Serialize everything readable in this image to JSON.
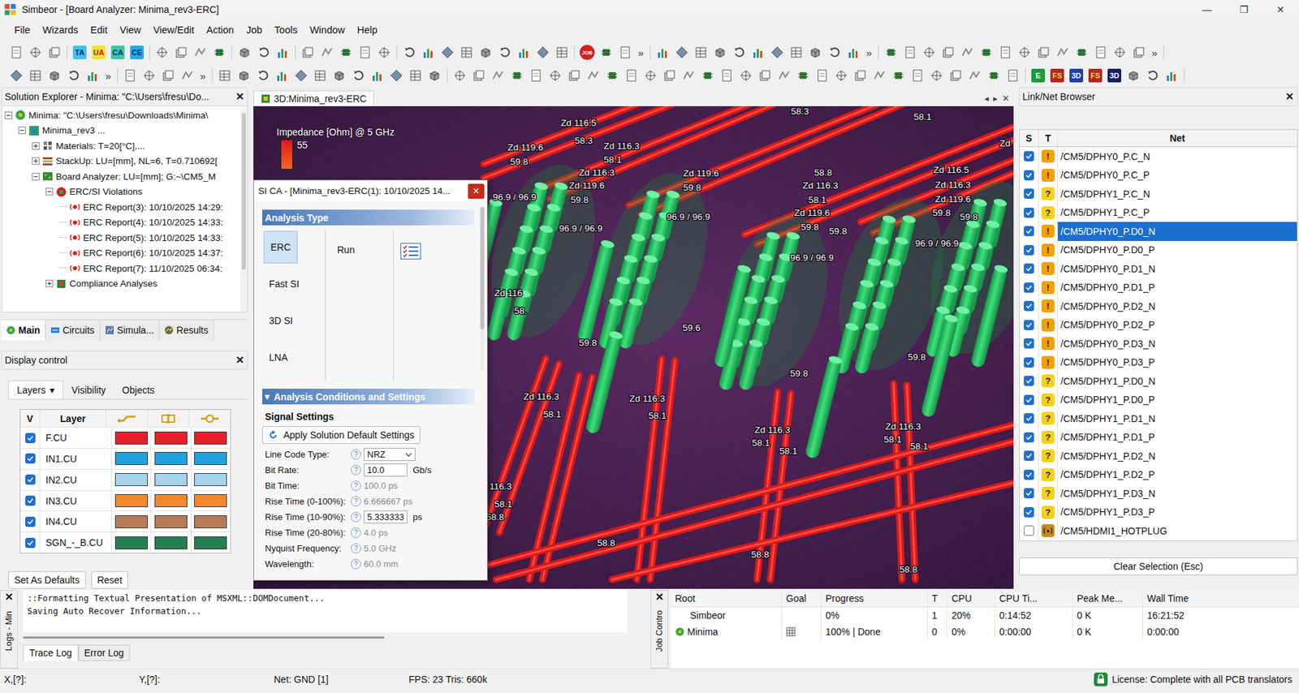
{
  "window": {
    "title": "Simbeor - [Board Analyzer: Minima_rev3-ERC]",
    "controls": [
      "—",
      "❐",
      "✕"
    ]
  },
  "menu": [
    "File",
    "Wizards",
    "Edit",
    "View",
    "View/Edit",
    "Action",
    "Job",
    "Tools",
    "Window",
    "Help"
  ],
  "toolbars": [
    [
      [
        {
          "kind": "icon"
        },
        {
          "kind": "icon"
        },
        {
          "kind": "icon"
        }
      ],
      [
        {
          "kind": "badge",
          "label": "TA",
          "color": "#3fc2e8",
          "text_color": "#0b2a8f"
        },
        {
          "kind": "badge",
          "label": "UA",
          "color": "#f7e03a",
          "text_color": "#d0161b"
        },
        {
          "kind": "badge",
          "label": "CA",
          "color": "#3ec7a0",
          "text_color": "#0b2a8f"
        },
        {
          "kind": "badge",
          "label": "CE",
          "color": "#2aa8e0",
          "text_color": "#0b2a8f"
        }
      ],
      [
        {
          "kind": "icon"
        },
        {
          "kind": "icon"
        },
        {
          "kind": "icon"
        },
        {
          "kind": "icon"
        }
      ],
      [
        {
          "kind": "icon"
        },
        {
          "kind": "icon"
        },
        {
          "kind": "icon"
        }
      ],
      [
        {
          "kind": "icon"
        },
        {
          "kind": "icon"
        },
        {
          "kind": "icon"
        },
        {
          "kind": "icon"
        },
        {
          "kind": "icon"
        }
      ],
      [
        {
          "kind": "icon"
        },
        {
          "kind": "icon"
        },
        {
          "kind": "icon"
        },
        {
          "kind": "icon"
        },
        {
          "kind": "icon"
        },
        {
          "kind": "icon"
        },
        {
          "kind": "icon"
        },
        {
          "kind": "icon"
        },
        {
          "kind": "icon"
        }
      ],
      [
        {
          "kind": "round",
          "label": "JOB",
          "color": "#d32020",
          "text_color": "#ffffff"
        },
        {
          "kind": "icon"
        },
        {
          "kind": "icon"
        },
        {
          "kind": "more",
          "label": "»"
        }
      ],
      [
        {
          "kind": "icon"
        },
        {
          "kind": "icon"
        },
        {
          "kind": "icon"
        },
        {
          "kind": "icon"
        },
        {
          "kind": "icon"
        },
        {
          "kind": "icon"
        },
        {
          "kind": "icon"
        },
        {
          "kind": "icon"
        },
        {
          "kind": "icon"
        },
        {
          "kind": "icon"
        },
        {
          "kind": "icon"
        },
        {
          "kind": "more",
          "label": "»"
        }
      ],
      [
        {
          "kind": "icon"
        },
        {
          "kind": "icon"
        },
        {
          "kind": "icon"
        },
        {
          "kind": "icon"
        },
        {
          "kind": "icon"
        },
        {
          "kind": "icon"
        },
        {
          "kind": "icon"
        },
        {
          "kind": "icon"
        },
        {
          "kind": "icon"
        },
        {
          "kind": "icon"
        },
        {
          "kind": "icon"
        },
        {
          "kind": "icon"
        },
        {
          "kind": "icon"
        },
        {
          "kind": "icon"
        },
        {
          "kind": "more",
          "label": "»"
        }
      ]
    ],
    [
      [
        {
          "kind": "icon"
        },
        {
          "kind": "icon"
        },
        {
          "kind": "icon"
        },
        {
          "kind": "icon"
        },
        {
          "kind": "icon"
        },
        {
          "kind": "more",
          "label": "»"
        }
      ],
      [
        {
          "kind": "icon"
        },
        {
          "kind": "icon"
        },
        {
          "kind": "icon"
        },
        {
          "kind": "icon"
        },
        {
          "kind": "more",
          "label": "»"
        }
      ],
      [
        {
          "kind": "icon"
        },
        {
          "kind": "icon"
        },
        {
          "kind": "icon"
        },
        {
          "kind": "icon"
        },
        {
          "kind": "icon"
        },
        {
          "kind": "icon"
        },
        {
          "kind": "icon"
        },
        {
          "kind": "icon"
        },
        {
          "kind": "icon"
        },
        {
          "kind": "icon"
        },
        {
          "kind": "icon"
        },
        {
          "kind": "icon"
        }
      ],
      [
        {
          "kind": "icon"
        },
        {
          "kind": "icon"
        },
        {
          "kind": "icon"
        },
        {
          "kind": "icon"
        },
        {
          "kind": "icon"
        },
        {
          "kind": "icon"
        },
        {
          "kind": "icon"
        },
        {
          "kind": "icon"
        },
        {
          "kind": "icon"
        },
        {
          "kind": "icon"
        },
        {
          "kind": "icon"
        },
        {
          "kind": "icon"
        },
        {
          "kind": "icon"
        },
        {
          "kind": "icon"
        },
        {
          "kind": "icon"
        },
        {
          "kind": "icon"
        },
        {
          "kind": "icon"
        },
        {
          "kind": "icon"
        },
        {
          "kind": "icon"
        },
        {
          "kind": "icon"
        },
        {
          "kind": "icon"
        },
        {
          "kind": "icon"
        },
        {
          "kind": "icon"
        },
        {
          "kind": "icon"
        },
        {
          "kind": "icon"
        },
        {
          "kind": "icon"
        },
        {
          "kind": "icon"
        },
        {
          "kind": "icon"
        },
        {
          "kind": "icon"
        },
        {
          "kind": "icon"
        }
      ],
      [
        {
          "kind": "badge",
          "label": "E",
          "color": "#1a9b3c",
          "text_color": "#ffffff"
        },
        {
          "kind": "badge",
          "label": "FS",
          "color": "#b3261e",
          "text_color": "#ffd54a"
        },
        {
          "kind": "badge",
          "label": "3D",
          "color": "#1c3fa8",
          "text_color": "#ffffff"
        },
        {
          "kind": "badge",
          "label": "FS",
          "color": "#b3261e",
          "text_color": "#ffd54a"
        },
        {
          "kind": "badge",
          "label": "3D",
          "color": "#13205e",
          "text_color": "#ffffff"
        },
        {
          "kind": "icon"
        },
        {
          "kind": "icon"
        },
        {
          "kind": "icon"
        }
      ]
    ]
  ],
  "solution_explorer": {
    "title": "Solution Explorer - Minima: \"C:\\Users\\fresu\\Do...",
    "close": "✕",
    "items": [
      {
        "label": "Minima: \"C:\\Users\\fresu\\Downloads\\Minima\\",
        "level": 0,
        "expandable": true,
        "expanded": true,
        "kind": "solution"
      },
      {
        "label": "Minima_rev3 ...",
        "level": 1,
        "expandable": true,
        "expanded": true,
        "kind": "doc"
      },
      {
        "label": "Materials: T=20[°C],...",
        "level": 2,
        "expandable": true,
        "expanded": false,
        "kind": "materials"
      },
      {
        "label": "StackUp: LU=[mm], NL=6, T=0.710692[",
        "level": 2,
        "expandable": true,
        "expanded": false,
        "kind": "stackup"
      },
      {
        "label": "Board Analyzer: LU=[mm]; G:~\\CM5_M",
        "level": 2,
        "expandable": true,
        "expanded": true,
        "kind": "board"
      },
      {
        "label": "ERC/SI Violations",
        "level": 3,
        "expandable": true,
        "expanded": true,
        "kind": "erc"
      },
      {
        "label": "ERC Report(3): 10/10/2025 14:29:",
        "level": 4,
        "expandable": false,
        "expanded": false,
        "kind": "report"
      },
      {
        "label": "ERC Report(4): 10/10/2025 14:33:",
        "level": 4,
        "expandable": false,
        "expanded": false,
        "kind": "report"
      },
      {
        "label": "ERC Report(5): 10/10/2025 14:33:",
        "level": 4,
        "expandable": false,
        "expanded": false,
        "kind": "report"
      },
      {
        "label": "ERC Report(6): 10/10/2025 14:37:",
        "level": 4,
        "expandable": false,
        "expanded": false,
        "kind": "report"
      },
      {
        "label": "ERC Report(7): 11/10/2025 06:34:",
        "level": 4,
        "expandable": false,
        "expanded": false,
        "kind": "report"
      },
      {
        "label": "Compliance Analyses",
        "level": 3,
        "expandable": true,
        "expanded": false,
        "kind": "compliance"
      }
    ]
  },
  "left_tabs": [
    {
      "label": "Main",
      "selected": true,
      "kind": "main"
    },
    {
      "label": "Circuits",
      "selected": false,
      "kind": "circuits"
    },
    {
      "label": "Simula...",
      "selected": false,
      "kind": "simulation"
    },
    {
      "label": "Results",
      "selected": false,
      "kind": "results"
    }
  ],
  "display_control": {
    "title": "Display control",
    "close": "✕",
    "tabs": [
      {
        "label": "Layers",
        "selected": true,
        "dropdown": "▾"
      },
      {
        "label": "Visibility",
        "selected": false
      },
      {
        "label": "Objects",
        "selected": false
      }
    ],
    "columns": [
      "V",
      "Layer"
    ],
    "layers": [
      {
        "name": "F.CU",
        "visible": true,
        "color": "#e5202a"
      },
      {
        "name": "IN1.CU",
        "visible": true,
        "color": "#1fa2e0"
      },
      {
        "name": "IN2.CU",
        "visible": true,
        "color": "#a6d3ee"
      },
      {
        "name": "IN3.CU",
        "visible": true,
        "color": "#f5882a"
      },
      {
        "name": "IN4.CU",
        "visible": true,
        "color": "#b87b58"
      },
      {
        "name": "SGN_-_B.CU",
        "visible": true,
        "color": "#24804f"
      }
    ],
    "buttons": [
      "Set As Defaults",
      "Reset"
    ]
  },
  "doc_tab": {
    "label": "3D:Minima_rev3-ERC",
    "nav": [
      "◂",
      "▸",
      "✕"
    ]
  },
  "canvas": {
    "legend": {
      "title": "Impedance [Ohm] @ 5 GHz",
      "value": "55"
    },
    "labels": [
      "58.3",
      "58.1",
      "Zd 116.5",
      "58.3",
      "Zd 116.3",
      "58.1",
      "Zd 119.6",
      "59.8",
      "Zd 116.3",
      "Zd 119.6",
      "59.8",
      "Zd 119.6",
      "59.8",
      "58.8",
      "Zd 116.3",
      "58.1",
      "Zd 119.6",
      "59.8",
      "59.8",
      "Zd 116.5",
      "Zd 116.3",
      "Zd 119.6",
      "59.8",
      "59.8",
      "Zd",
      "96.9 / 96.9",
      "96.9 / 96.9",
      "96.9 / 96.9",
      "96.9 / 96.9",
      "96.9 / 96.9",
      "Zd 116",
      "58.",
      "59.8",
      "59.6",
      "59.8",
      "59.8",
      "Zd 116.3",
      "58.1",
      "Zd 116.3",
      "58.1",
      "Zd 116.3",
      "58.1",
      "58.1",
      "Zd 116.3",
      "58.1",
      "58.1",
      "116.3",
      "58.1",
      "58.8",
      "58.8",
      "58.8",
      "58.8"
    ]
  },
  "dialog": {
    "title": "SI CA - [Minima_rev3-ERC(1): 10/10/2025 14...",
    "close": "×",
    "analysis_header": "Analysis Type",
    "analysis_types": [
      {
        "label": "ERC",
        "selected": true
      },
      {
        "label": "Fast SI",
        "selected": false
      },
      {
        "label": "3D SI",
        "selected": false
      },
      {
        "label": "LNA",
        "selected": false
      }
    ],
    "run": "Run",
    "settings_glyph": "▾",
    "settings_header": "Analysis Conditions and Settings",
    "group": "Signal Settings",
    "apply_button": "Apply Solution Default Settings",
    "help_glyph": "?",
    "fields": [
      {
        "label": "Line Code Type:",
        "value": "NRZ",
        "kind": "select"
      },
      {
        "label": "Bit Rate:",
        "value": "10.0",
        "unit": "Gb/s",
        "kind": "input"
      },
      {
        "label": "Bit Time:",
        "value": "100.0 ps",
        "kind": "readonly"
      },
      {
        "label": "Rise Time (0-100%):",
        "value": "6.666667 ps",
        "kind": "readonly"
      },
      {
        "label": "Rise Time (10-90%):",
        "value": "5.333333",
        "unit": "ps",
        "kind": "input"
      },
      {
        "label": "Rise Time (20-80%):",
        "value": "4.0 ps",
        "kind": "readonly"
      },
      {
        "label": "Nyquist Frequency:",
        "value": "5.0 GHz",
        "kind": "readonly"
      },
      {
        "label": "Wavelength:",
        "value": "60.0 mm",
        "kind": "readonly"
      }
    ]
  },
  "net_browser": {
    "title": "Link/Net Browser",
    "close": "✕",
    "columns": [
      "S",
      "T",
      "Net"
    ],
    "rows": [
      {
        "net": "/CM5/DPHY0_P.C_N",
        "checked": true,
        "selected": false,
        "type_glyph": "!",
        "type_color": "#f5a000"
      },
      {
        "net": "/CM5/DPHY0_P.C_P",
        "checked": true,
        "selected": false,
        "type_glyph": "!",
        "type_color": "#f5a000"
      },
      {
        "net": "/CM5/DPHY1_P.C_N",
        "checked": true,
        "selected": false,
        "type_glyph": "?",
        "type_color": "#f7d118"
      },
      {
        "net": "/CM5/DPHY1_P.C_P",
        "checked": true,
        "selected": false,
        "type_glyph": "?",
        "type_color": "#f7d118"
      },
      {
        "net": "/CM5/DPHY0_P.D0_N",
        "checked": true,
        "selected": true,
        "type_glyph": "!",
        "type_color": "#f5a000"
      },
      {
        "net": "/CM5/DPHY0_P.D0_P",
        "checked": true,
        "selected": false,
        "type_glyph": "!",
        "type_color": "#f5a000"
      },
      {
        "net": "/CM5/DPHY0_P.D1_N",
        "checked": true,
        "selected": false,
        "type_glyph": "!",
        "type_color": "#f5a000"
      },
      {
        "net": "/CM5/DPHY0_P.D1_P",
        "checked": true,
        "selected": false,
        "type_glyph": "!",
        "type_color": "#f5a000"
      },
      {
        "net": "/CM5/DPHY0_P.D2_N",
        "checked": true,
        "selected": false,
        "type_glyph": "!",
        "type_color": "#f5a000"
      },
      {
        "net": "/CM5/DPHY0_P.D2_P",
        "checked": true,
        "selected": false,
        "type_glyph": "!",
        "type_color": "#f5a000"
      },
      {
        "net": "/CM5/DPHY0_P.D3_N",
        "checked": true,
        "selected": false,
        "type_glyph": "!",
        "type_color": "#f5a000"
      },
      {
        "net": "/CM5/DPHY0_P.D3_P",
        "checked": true,
        "selected": false,
        "type_glyph": "!",
        "type_color": "#f5a000"
      },
      {
        "net": "/CM5/DPHY1_P.D0_N",
        "checked": true,
        "selected": false,
        "type_glyph": "?",
        "type_color": "#f7d118"
      },
      {
        "net": "/CM5/DPHY1_P.D0_P",
        "checked": true,
        "selected": false,
        "type_glyph": "?",
        "type_color": "#f7d118"
      },
      {
        "net": "/CM5/DPHY1_P.D1_N",
        "checked": true,
        "selected": false,
        "type_glyph": "?",
        "type_color": "#f7d118"
      },
      {
        "net": "/CM5/DPHY1_P.D1_P",
        "checked": true,
        "selected": false,
        "type_glyph": "?",
        "type_color": "#f7d118"
      },
      {
        "net": "/CM5/DPHY1_P.D2_N",
        "checked": true,
        "selected": false,
        "type_glyph": "?",
        "type_color": "#f7d118"
      },
      {
        "net": "/CM5/DPHY1_P.D2_P",
        "checked": true,
        "selected": false,
        "type_glyph": "?",
        "type_color": "#f7d118"
      },
      {
        "net": "/CM5/DPHY1_P.D3_N",
        "checked": true,
        "selected": false,
        "type_glyph": "?",
        "type_color": "#f7d118"
      },
      {
        "net": "/CM5/DPHY1_P.D3_P",
        "checked": true,
        "selected": false,
        "type_glyph": "?",
        "type_color": "#f7d118"
      },
      {
        "net": "/CM5/HDMI1_HOTPLUG",
        "checked": false,
        "selected": false,
        "type_glyph": "•",
        "type_color": "#c98a1e"
      }
    ],
    "button": "Clear Selection (Esc)"
  },
  "logs": {
    "side_label": "Logs - Min",
    "close": "✕",
    "lines": [
      "::Formatting Textual Presentation of MSXML::DOMDocument...",
      "Saving Auto Recover Information..."
    ],
    "tabs": [
      {
        "label": "Trace Log",
        "selected": true
      },
      {
        "label": "Error Log",
        "selected": false
      }
    ]
  },
  "job_control": {
    "side_label": "Job Contro",
    "close": "✕",
    "columns": [
      "Root",
      "Goal",
      "Progress",
      "T",
      "CPU",
      "CPU Ti...",
      "Peak Me...",
      "Wall Time"
    ],
    "rows": [
      {
        "name": "Simbeor",
        "kind": "app",
        "progress": "0%",
        "t": "1",
        "cpu": "20%",
        "cpu_time": "0:14:52",
        "peak": "0 K",
        "wall": "16:21:52"
      },
      {
        "name": "Minima",
        "kind": "solution",
        "progress": "100% | Done",
        "t": "0",
        "cpu": "0%",
        "cpu_time": "0:00:00",
        "peak": "0 K",
        "wall": "0:00:00"
      }
    ]
  },
  "status_bar": {
    "x": "X,[?]:",
    "y": "Y,[?]:",
    "net": "Net: GND [1]",
    "fps": "FPS: 23 Tris: 660k",
    "license": "License: Complete with all PCB translators"
  }
}
